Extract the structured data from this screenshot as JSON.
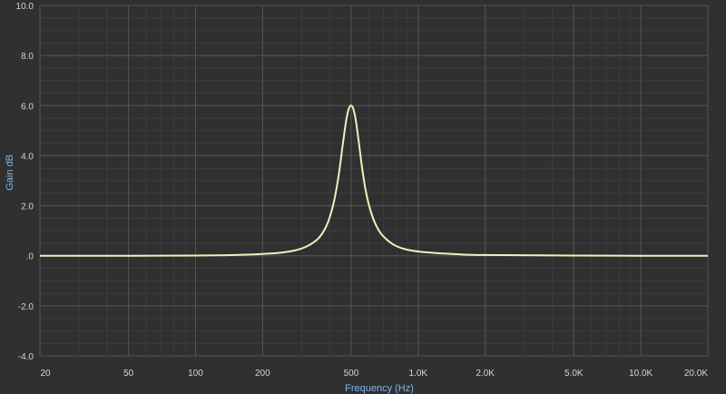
{
  "chart_data": {
    "type": "line",
    "xlabel": "Frequency (Hz)",
    "ylabel": "Gain dB",
    "x_scale": "log",
    "xlim": [
      20,
      20000
    ],
    "ylim": [
      -4.0,
      10.0
    ],
    "x_ticks": [
      {
        "value": 20,
        "label": "20"
      },
      {
        "value": 50,
        "label": "50"
      },
      {
        "value": 100,
        "label": "100"
      },
      {
        "value": 200,
        "label": "200"
      },
      {
        "value": 500,
        "label": "500"
      },
      {
        "value": 1000,
        "label": "1.0K"
      },
      {
        "value": 2000,
        "label": "2.0K"
      },
      {
        "value": 5000,
        "label": "5.0K"
      },
      {
        "value": 10000,
        "label": "10.0K"
      },
      {
        "value": 20000,
        "label": "20.0K"
      }
    ],
    "y_ticks": [
      {
        "value": 10,
        "label": "10.0"
      },
      {
        "value": 8,
        "label": "8.0"
      },
      {
        "value": 6,
        "label": "6.0"
      },
      {
        "value": 4,
        "label": "4.0"
      },
      {
        "value": 2,
        "label": "2.0"
      },
      {
        "value": 0,
        "label": ".0"
      },
      {
        "value": -2,
        "label": "-2.0"
      },
      {
        "value": -4,
        "label": "-4.0"
      }
    ],
    "grid": true,
    "series": [
      {
        "color": "#f2efbe",
        "x": [
          20,
          50,
          100,
          150,
          200,
          250,
          300,
          350,
          380,
          400,
          420,
          440,
          460,
          480,
          500,
          520,
          540,
          560,
          580,
          600,
          630,
          660,
          700,
          800,
          1000,
          1500,
          2000,
          5000,
          10000,
          20000
        ],
        "y": [
          0.0,
          0.0,
          0.01,
          0.03,
          0.07,
          0.14,
          0.29,
          0.63,
          1.05,
          1.52,
          2.23,
          3.25,
          4.54,
          5.63,
          6.0,
          5.6,
          4.6,
          3.5,
          2.65,
          2.05,
          1.45,
          1.07,
          0.76,
          0.38,
          0.17,
          0.06,
          0.03,
          0.01,
          0.0,
          0.0
        ]
      }
    ],
    "colors": {
      "background": "#303030",
      "grid_major": "#555555",
      "grid_minor": "#3c3c3c",
      "curve": "#f2efbe",
      "tick_label": "#d4d4d4",
      "axis_title": "#7fb6e6"
    }
  }
}
